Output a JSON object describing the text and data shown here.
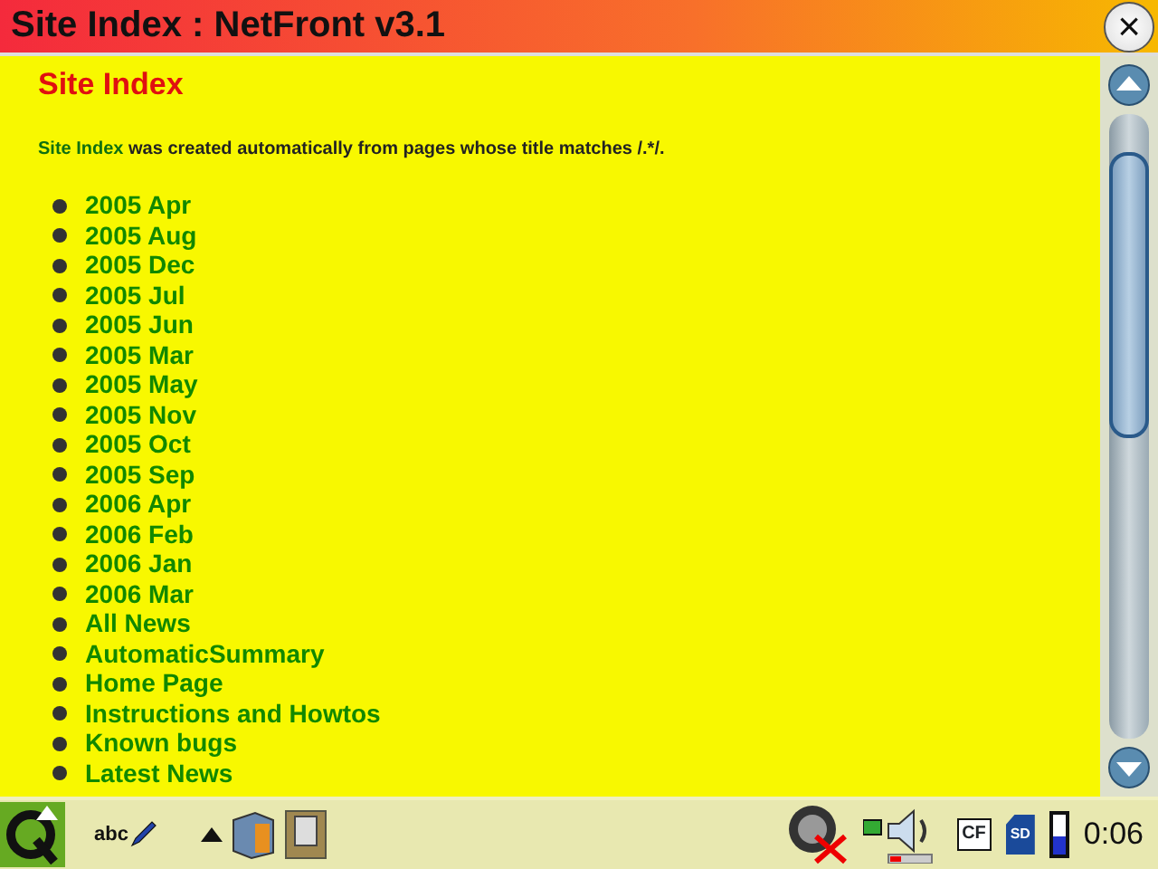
{
  "window": {
    "title": "Site Index : NetFront v3.1",
    "close": "×"
  },
  "page": {
    "heading": "Site Index",
    "intro": "**Site Index** was created automatically from pages whose title matches /.*/.",
    "links": [
      "2005 Apr",
      "2005 Aug",
      "2005 Dec",
      "2005 Jul",
      "2005 Jun",
      "2005 Mar",
      "2005 May",
      "2005 Nov",
      "2005 Oct",
      "2005 Sep",
      "2006 Apr",
      "2006 Feb",
      "2006 Jan",
      "2006 Mar",
      "All News",
      "AutomaticSummary",
      "Home Page",
      "Instructions and Howtos",
      "Known bugs",
      "Latest News"
    ]
  },
  "taskbar": {
    "input_method": "abc",
    "tray": {
      "cf_label": "CF",
      "sd_label": "SD"
    },
    "clock": "0:06"
  }
}
